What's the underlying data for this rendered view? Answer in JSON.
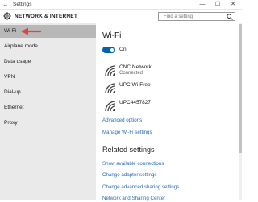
{
  "window": {
    "app_title": "Settings",
    "back_glyph": "←",
    "minimize_glyph": "—",
    "maximize_glyph": "☐",
    "close_glyph": "✕"
  },
  "header": {
    "section_title": "NETWORK & INTERNET",
    "icon": "gear-icon"
  },
  "search": {
    "placeholder": "Find a setting",
    "icon": "search-icon"
  },
  "sidebar": {
    "items": [
      {
        "label": "Wi-Fi",
        "selected": true
      },
      {
        "label": "Airplane mode"
      },
      {
        "label": "Data usage"
      },
      {
        "label": "VPN"
      },
      {
        "label": "Dial-up"
      },
      {
        "label": "Ethernet"
      },
      {
        "label": "Proxy"
      }
    ]
  },
  "main": {
    "title": "Wi-Fi",
    "toggle": {
      "state_label": "On",
      "on": true
    },
    "networks": [
      {
        "name": "CNC Network",
        "status": "Connected",
        "icon": "wifi-signal-icon"
      },
      {
        "name": "UPC Wi-Free",
        "status": "",
        "icon": "wifi-signal-icon"
      },
      {
        "name": "UPC4457827",
        "status": "",
        "icon": "wifi-signal-icon"
      }
    ],
    "links": {
      "advanced": "Advanced options",
      "manage": "Manage Wi-Fi settings"
    },
    "related": {
      "title": "Related settings",
      "links": [
        "Show available connections",
        "Change adapter settings",
        "Change advanced sharing settings",
        "Network and Sharing Center"
      ]
    }
  },
  "colors": {
    "accent": "#0063b1",
    "link": "#2a6ab3",
    "sidebar_bg": "#eaeaea",
    "selected_bg": "#b8b8b8",
    "annotation_arrow": "#e8403a"
  }
}
